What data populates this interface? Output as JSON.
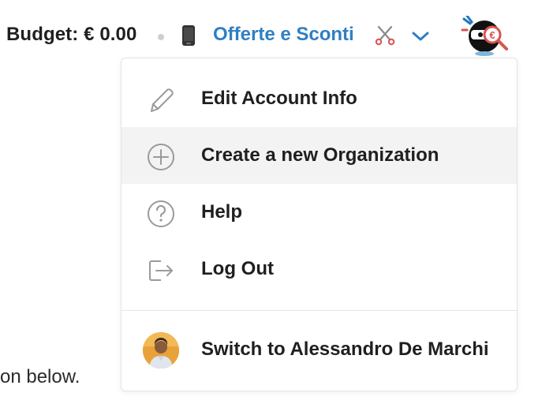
{
  "header": {
    "budget_label": "Budget: € 0.00",
    "org_name": "Offerte e Sconti",
    "phone_icon": "mobile-phone-icon",
    "scissors_icon": "scissors-icon",
    "chevron_icon": "chevron-down-icon",
    "avatar_icon": "ninja-mascot-avatar",
    "org_color": "#2f7fc4"
  },
  "background": {
    "partial_text": "on below."
  },
  "menu": {
    "items": [
      {
        "label": "Edit Account Info",
        "icon": "pencil-icon"
      },
      {
        "label": "Create a new Organization",
        "icon": "plus-circle-icon",
        "highlighted": true
      },
      {
        "label": "Help",
        "icon": "question-circle-icon"
      },
      {
        "label": "Log Out",
        "icon": "logout-icon"
      }
    ],
    "switch": {
      "label": "Switch to Alessandro De Marchi",
      "avatar": "user-photo-avatar"
    },
    "highlight_color": "#f3f3f3"
  }
}
